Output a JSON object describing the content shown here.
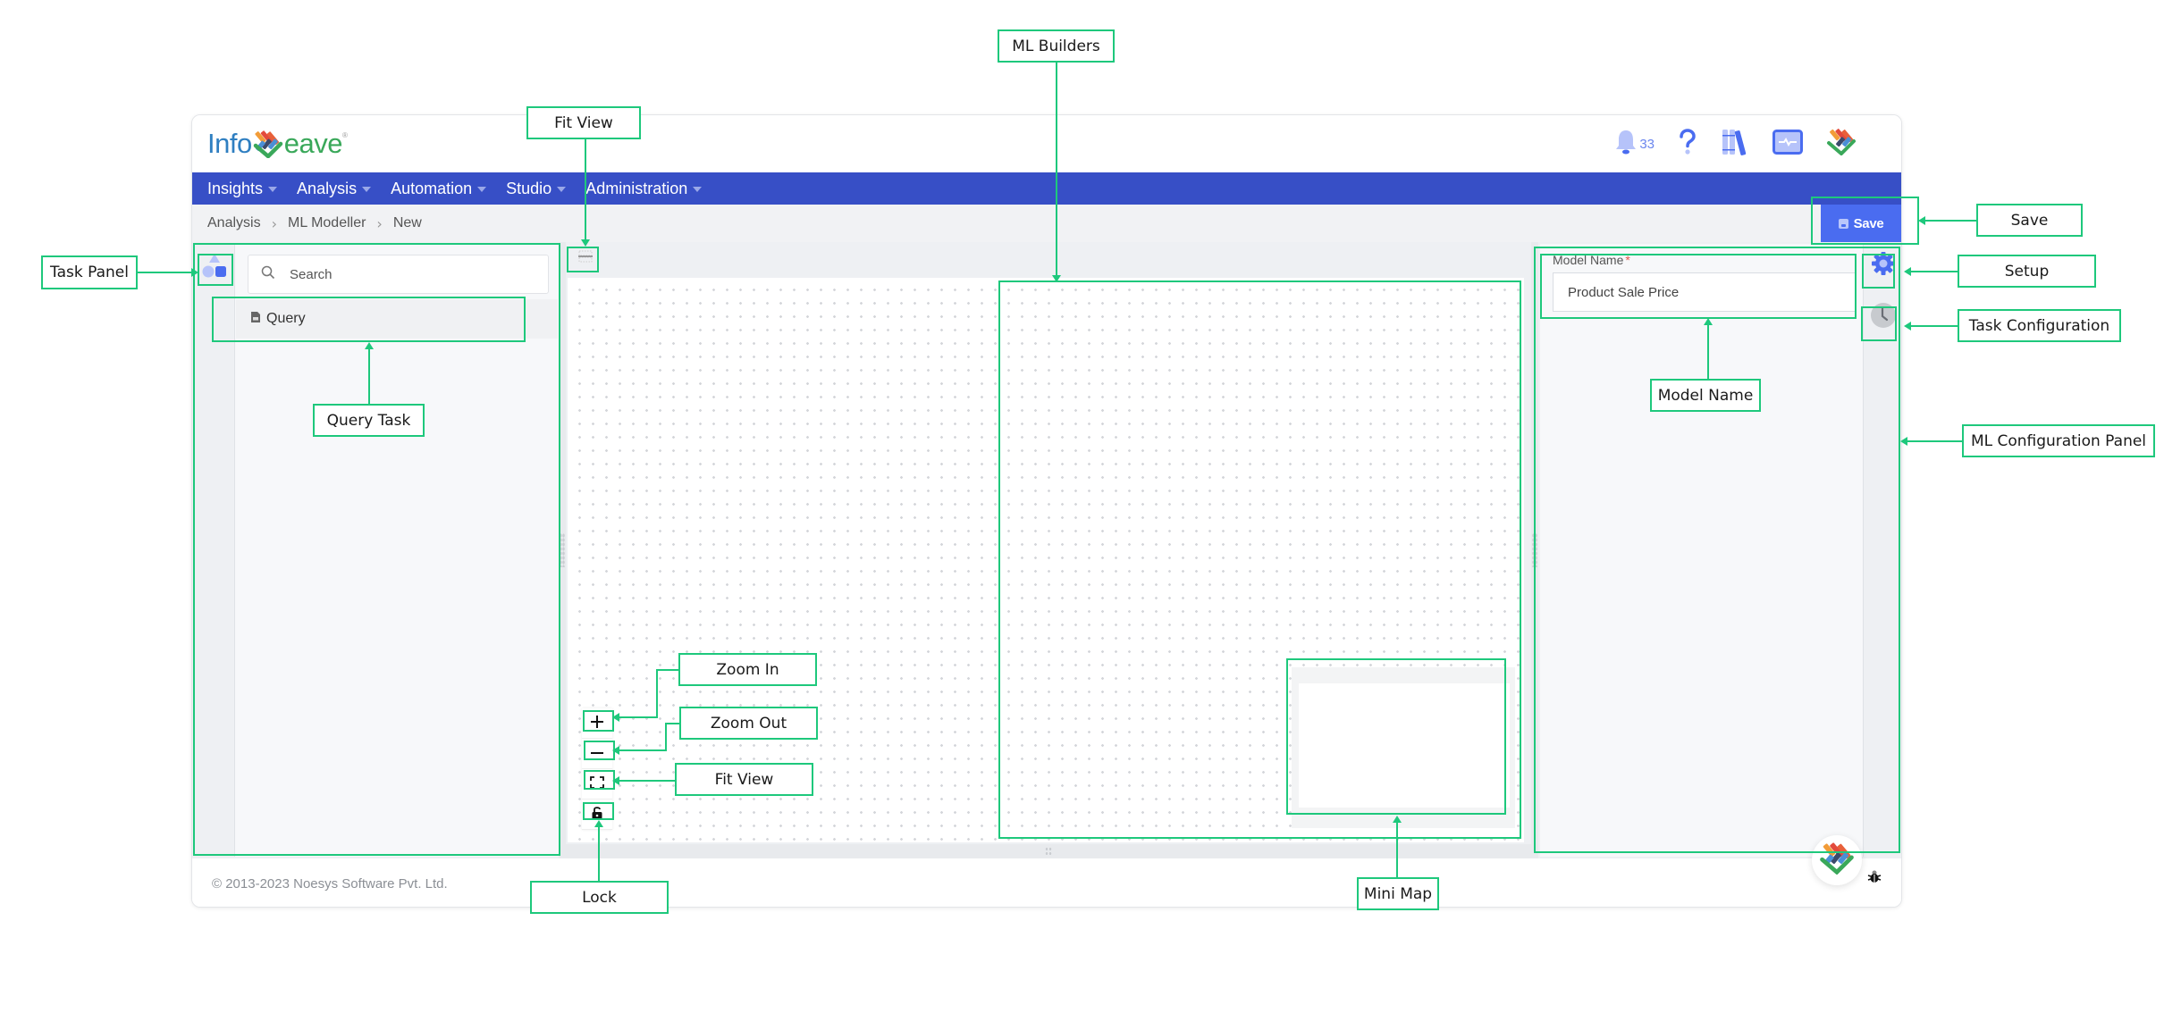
{
  "app": {
    "logo": {
      "prefix": "Info",
      "suffix": "eave",
      "registered": "®"
    },
    "notifications": {
      "count": "33"
    },
    "top_icons": [
      "bell-icon",
      "help-icon",
      "library-icon",
      "monitor-icon",
      "infoveave-mark-icon"
    ],
    "nav": [
      {
        "label": "Insights"
      },
      {
        "label": "Analysis"
      },
      {
        "label": "Automation"
      },
      {
        "label": "Studio"
      },
      {
        "label": "Administration"
      }
    ],
    "breadcrumb": [
      "Analysis",
      "ML Modeller",
      "New"
    ],
    "breadcrumb_separator": "›",
    "save_label": "Save",
    "colors": {
      "nav": "#374fc6",
      "accent": "#4a6cf0",
      "annotation": "#1ec87c"
    }
  },
  "task_panel": {
    "search_placeholder": "Search",
    "items": [
      {
        "label": "Query",
        "icon": "document-icon"
      }
    ]
  },
  "canvas": {
    "controls": [
      "zoom-in",
      "zoom-out",
      "fit-view",
      "lock"
    ]
  },
  "config_panel": {
    "model_name_label": "Model Name",
    "required_mark": "*",
    "model_name_value": "Product Sale Price"
  },
  "footer": {
    "copyright": "© 2013-2023 Noesys Software Pvt. Ltd."
  },
  "annotations": {
    "ml_builders": "ML Builders",
    "fit_view_top": "Fit View",
    "task_panel": "Task Panel",
    "query_task": "Query Task",
    "save": "Save",
    "setup": "Setup",
    "task_configuration": "Task Configuration",
    "model_name": "Model Name",
    "ml_configuration_panel": "ML Configuration Panel",
    "zoom_in": "Zoom In",
    "zoom_out": "Zoom Out",
    "fit_view": "Fit View",
    "lock": "Lock",
    "mini_map": "Mini Map"
  }
}
